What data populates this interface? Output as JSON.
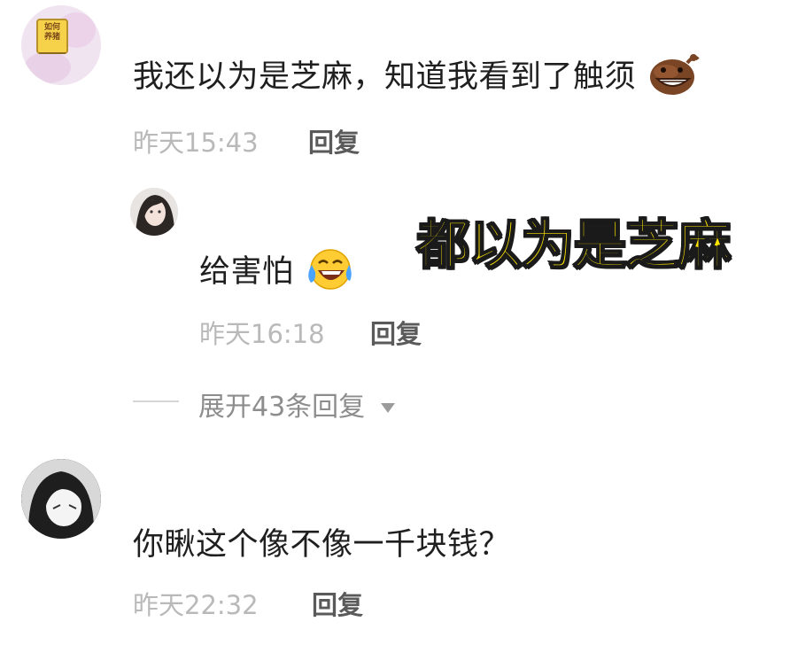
{
  "comments": [
    {
      "avatar": {
        "badge_text": "如何\n养猪"
      },
      "text": "我还以为是芝麻，知道我看到了触须",
      "trailing_emoji": "brown-face-emoji",
      "time": "昨天15:43",
      "reply_label": "回复",
      "replies": [
        {
          "text": "给害怕",
          "trailing_emoji": "laughing-crying-emoji",
          "time": "昨天16:18",
          "reply_label": "回复"
        }
      ],
      "expand_label": "展开43条回复"
    },
    {
      "text": "你瞅这个像不像一千块钱？",
      "time": "昨天22:32",
      "reply_label": "回复"
    }
  ],
  "overlay_caption": "都以为是芝麻",
  "colors": {
    "caption_fill": "#ffe600",
    "caption_stroke": "#1a1a1a",
    "time_text": "#b9b9b9",
    "reply_text": "#5a5a5a",
    "expand_text": "#8d8d8d"
  }
}
